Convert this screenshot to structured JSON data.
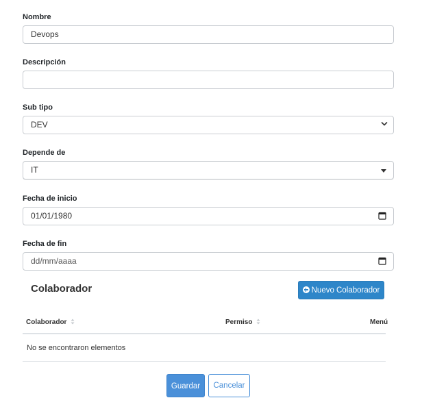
{
  "form": {
    "nombre": {
      "label": "Nombre",
      "value": "Devops"
    },
    "descripcion": {
      "label": "Descripción",
      "value": ""
    },
    "sub_tipo": {
      "label": "Sub tipo",
      "value": "DEV"
    },
    "depende_de": {
      "label": "Depende de",
      "value": "IT"
    },
    "fecha_inicio": {
      "label": "Fecha de inicio",
      "value": "01/01/1980"
    },
    "fecha_fin": {
      "label": "Fecha de fin",
      "placeholder": "dd/mm/aaaa"
    }
  },
  "colaborador": {
    "title": "Colaborador",
    "new_button": "Nuevo Colaborador",
    "columns": [
      "Colaborador",
      "Permiso",
      "Menú"
    ],
    "empty_message": "No se encontraron elementos"
  },
  "actions": {
    "save": "Guardar",
    "cancel": "Cancelar"
  },
  "icons": {
    "new": "plus-circle-icon",
    "date": "calendar-icon",
    "select": "chevron-down-icon",
    "dropdown": "caret-down-icon",
    "sort": "sort-icon"
  },
  "colors": {
    "primary": "#2e86c9",
    "save": "#4a90d9",
    "border": "#c8ccd1"
  }
}
